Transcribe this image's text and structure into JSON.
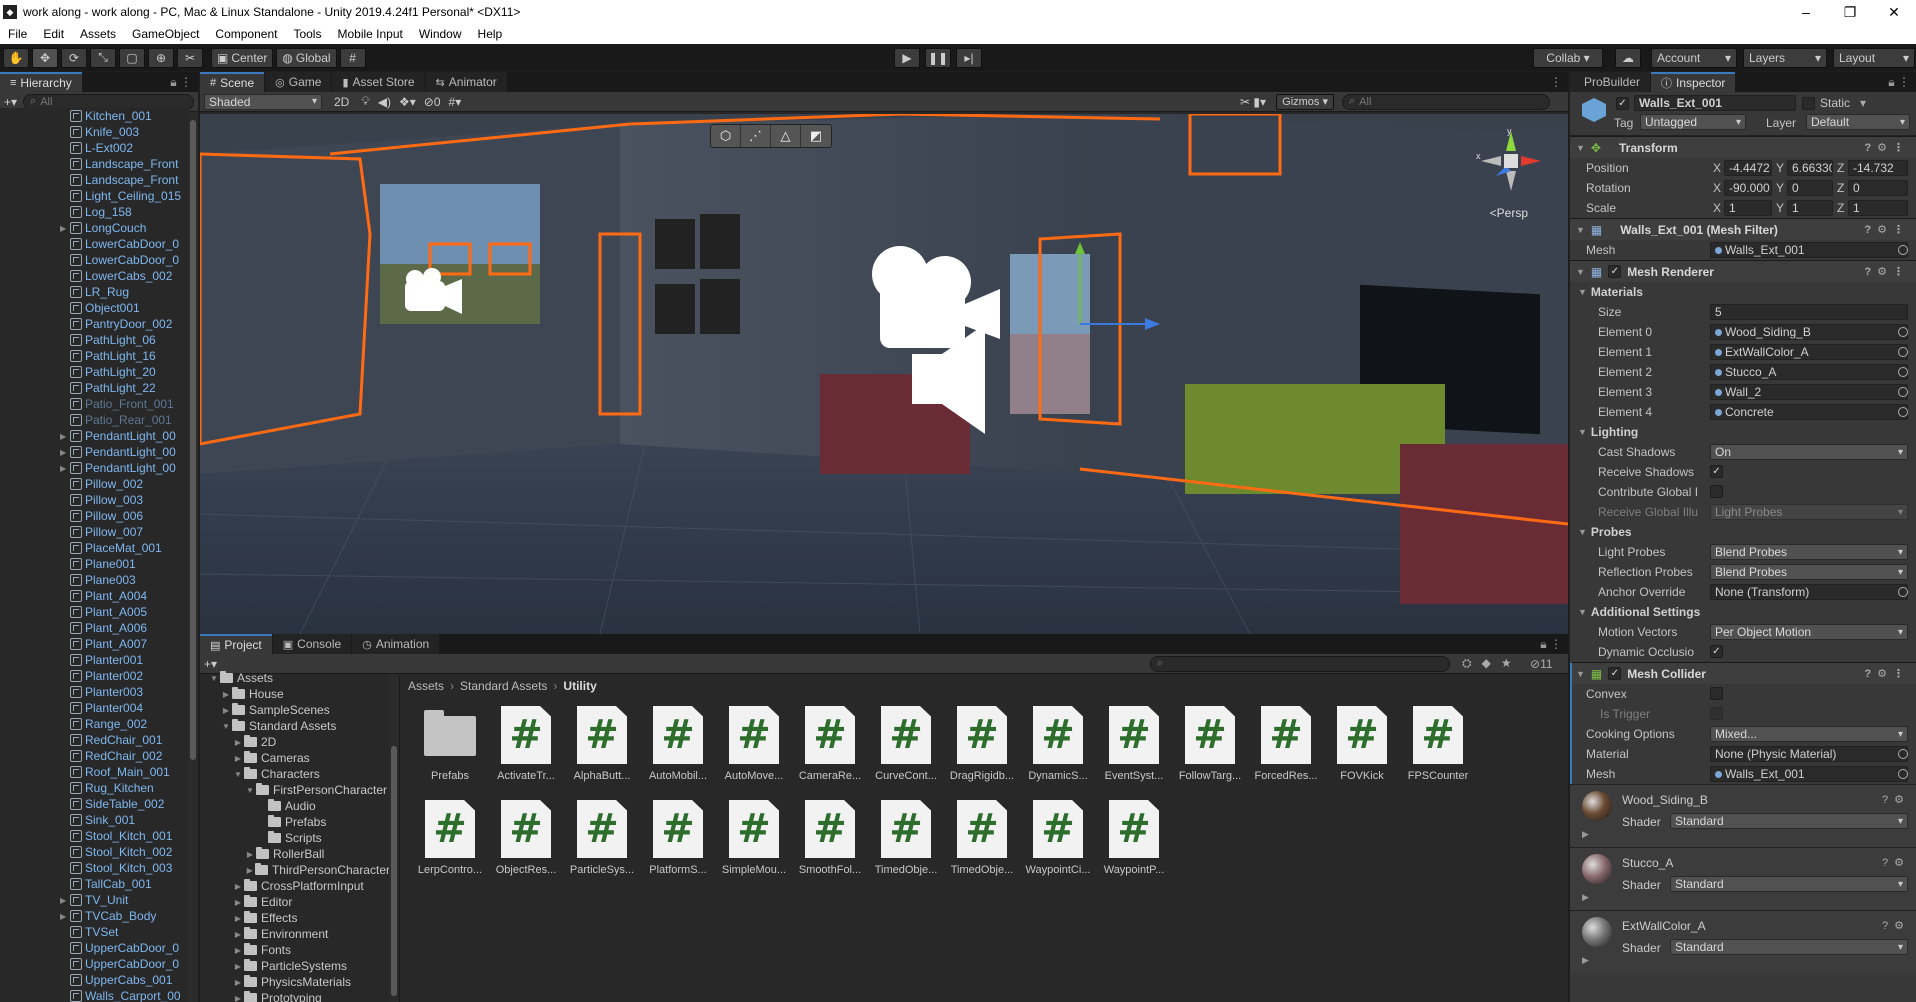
{
  "window": {
    "title": "work along - work along - PC, Mac & Linux Standalone - Unity 2019.4.24f1 Personal* <DX11>"
  },
  "menu": [
    "File",
    "Edit",
    "Assets",
    "GameObject",
    "Component",
    "Tools",
    "Mobile Input",
    "Window",
    "Help"
  ],
  "toolbar": {
    "center_label": "Center",
    "global_label": "Global",
    "collab_label": "Collab ▾",
    "account_label": "Account",
    "layers_label": "Layers",
    "layout_label": "Layout"
  },
  "hierarchy": {
    "tab": "Hierarchy",
    "search_placeholder": "All",
    "items": [
      {
        "name": "Kitchen_001",
        "arrow": false,
        "dim": false
      },
      {
        "name": "Knife_003",
        "arrow": false,
        "dim": false
      },
      {
        "name": "L-Ext002",
        "arrow": false,
        "dim": false
      },
      {
        "name": "Landscape_Front",
        "arrow": false,
        "dim": false
      },
      {
        "name": "Landscape_Front",
        "arrow": false,
        "dim": false
      },
      {
        "name": "Light_Ceiling_015",
        "arrow": false,
        "dim": false
      },
      {
        "name": "Log_158",
        "arrow": false,
        "dim": false
      },
      {
        "name": "LongCouch",
        "arrow": true,
        "dim": false
      },
      {
        "name": "LowerCabDoor_0",
        "arrow": false,
        "dim": false
      },
      {
        "name": "LowerCabDoor_0",
        "arrow": false,
        "dim": false
      },
      {
        "name": "LowerCabs_002",
        "arrow": false,
        "dim": false
      },
      {
        "name": "LR_Rug",
        "arrow": false,
        "dim": false
      },
      {
        "name": "Object001",
        "arrow": false,
        "dim": false
      },
      {
        "name": "PantryDoor_002",
        "arrow": false,
        "dim": false
      },
      {
        "name": "PathLight_06",
        "arrow": false,
        "dim": false
      },
      {
        "name": "PathLight_16",
        "arrow": false,
        "dim": false
      },
      {
        "name": "PathLight_20",
        "arrow": false,
        "dim": false
      },
      {
        "name": "PathLight_22",
        "arrow": false,
        "dim": false
      },
      {
        "name": "Patio_Front_001",
        "arrow": false,
        "dim": true
      },
      {
        "name": "Patio_Rear_001",
        "arrow": false,
        "dim": true
      },
      {
        "name": "PendantLight_00",
        "arrow": true,
        "dim": false
      },
      {
        "name": "PendantLight_00",
        "arrow": true,
        "dim": false
      },
      {
        "name": "PendantLight_00",
        "arrow": true,
        "dim": false
      },
      {
        "name": "Pillow_002",
        "arrow": false,
        "dim": false
      },
      {
        "name": "Pillow_003",
        "arrow": false,
        "dim": false
      },
      {
        "name": "Pillow_006",
        "arrow": false,
        "dim": false
      },
      {
        "name": "Pillow_007",
        "arrow": false,
        "dim": false
      },
      {
        "name": "PlaceMat_001",
        "arrow": false,
        "dim": false
      },
      {
        "name": "Plane001",
        "arrow": false,
        "dim": false
      },
      {
        "name": "Plane003",
        "arrow": false,
        "dim": false
      },
      {
        "name": "Plant_A004",
        "arrow": false,
        "dim": false
      },
      {
        "name": "Plant_A005",
        "arrow": false,
        "dim": false
      },
      {
        "name": "Plant_A006",
        "arrow": false,
        "dim": false
      },
      {
        "name": "Plant_A007",
        "arrow": false,
        "dim": false
      },
      {
        "name": "Planter001",
        "arrow": false,
        "dim": false
      },
      {
        "name": "Planter002",
        "arrow": false,
        "dim": false
      },
      {
        "name": "Planter003",
        "arrow": false,
        "dim": false
      },
      {
        "name": "Planter004",
        "arrow": false,
        "dim": false
      },
      {
        "name": "Range_002",
        "arrow": false,
        "dim": false
      },
      {
        "name": "RedChair_001",
        "arrow": false,
        "dim": false
      },
      {
        "name": "RedChair_002",
        "arrow": false,
        "dim": false
      },
      {
        "name": "Roof_Main_001",
        "arrow": false,
        "dim": false
      },
      {
        "name": "Rug_Kitchen",
        "arrow": false,
        "dim": false
      },
      {
        "name": "SideTable_002",
        "arrow": false,
        "dim": false
      },
      {
        "name": "Sink_001",
        "arrow": false,
        "dim": false
      },
      {
        "name": "Stool_Kitch_001",
        "arrow": false,
        "dim": false
      },
      {
        "name": "Stool_Kitch_002",
        "arrow": false,
        "dim": false
      },
      {
        "name": "Stool_Kitch_003",
        "arrow": false,
        "dim": false
      },
      {
        "name": "TallCab_001",
        "arrow": false,
        "dim": false
      },
      {
        "name": "TV_Unit",
        "arrow": true,
        "dim": false
      },
      {
        "name": "TVCab_Body",
        "arrow": true,
        "dim": false
      },
      {
        "name": "TVSet",
        "arrow": false,
        "dim": false
      },
      {
        "name": "UpperCabDoor_0",
        "arrow": false,
        "dim": false
      },
      {
        "name": "UpperCabDoor_0",
        "arrow": false,
        "dim": false
      },
      {
        "name": "UpperCabs_001",
        "arrow": false,
        "dim": false
      },
      {
        "name": "Walls_Carport_00",
        "arrow": false,
        "dim": false
      }
    ]
  },
  "scene": {
    "tabs": [
      "Scene",
      "Game",
      "Asset Store",
      "Animator"
    ],
    "shading": "Shaded",
    "mode_2d": "2D",
    "gizmos_label": "Gizmos",
    "search_placeholder": "All",
    "persp_label": "<Persp",
    "hidden_count": "0",
    "axis_y": "y",
    "axis_x": "x"
  },
  "project": {
    "tabs": [
      "Project",
      "Console",
      "Animation"
    ],
    "hidden_count": "11",
    "tree": [
      {
        "name": "Assets",
        "depth": 0,
        "arrow": "open"
      },
      {
        "name": "House",
        "depth": 1,
        "arrow": "closed"
      },
      {
        "name": "SampleScenes",
        "depth": 1,
        "arrow": "closed"
      },
      {
        "name": "Standard Assets",
        "depth": 1,
        "arrow": "open"
      },
      {
        "name": "2D",
        "depth": 2,
        "arrow": "closed"
      },
      {
        "name": "Cameras",
        "depth": 2,
        "arrow": "closed"
      },
      {
        "name": "Characters",
        "depth": 2,
        "arrow": "open"
      },
      {
        "name": "FirstPersonCharacter",
        "depth": 3,
        "arrow": "open"
      },
      {
        "name": "Audio",
        "depth": 4,
        "arrow": "none"
      },
      {
        "name": "Prefabs",
        "depth": 4,
        "arrow": "none"
      },
      {
        "name": "Scripts",
        "depth": 4,
        "arrow": "none"
      },
      {
        "name": "RollerBall",
        "depth": 3,
        "arrow": "closed"
      },
      {
        "name": "ThirdPersonCharacter",
        "depth": 3,
        "arrow": "closed"
      },
      {
        "name": "CrossPlatformInput",
        "depth": 2,
        "arrow": "closed"
      },
      {
        "name": "Editor",
        "depth": 2,
        "arrow": "closed"
      },
      {
        "name": "Effects",
        "depth": 2,
        "arrow": "closed"
      },
      {
        "name": "Environment",
        "depth": 2,
        "arrow": "closed"
      },
      {
        "name": "Fonts",
        "depth": 2,
        "arrow": "closed"
      },
      {
        "name": "ParticleSystems",
        "depth": 2,
        "arrow": "closed"
      },
      {
        "name": "PhysicsMaterials",
        "depth": 2,
        "arrow": "closed"
      },
      {
        "name": "Prototyping",
        "depth": 2,
        "arrow": "closed"
      }
    ],
    "breadcrumb": [
      "Assets",
      "Standard Assets",
      "Utility"
    ],
    "assets": [
      {
        "name": "Prefabs",
        "type": "folder"
      },
      {
        "name": "ActivateTr...",
        "type": "script"
      },
      {
        "name": "AlphaButt...",
        "type": "script"
      },
      {
        "name": "AutoMobil...",
        "type": "script"
      },
      {
        "name": "AutoMove...",
        "type": "script"
      },
      {
        "name": "CameraRe...",
        "type": "script"
      },
      {
        "name": "CurveCont...",
        "type": "script"
      },
      {
        "name": "DragRigidb...",
        "type": "script"
      },
      {
        "name": "DynamicS...",
        "type": "script"
      },
      {
        "name": "EventSyst...",
        "type": "script"
      },
      {
        "name": "FollowTarg...",
        "type": "script"
      },
      {
        "name": "ForcedRes...",
        "type": "script"
      },
      {
        "name": "FOVKick",
        "type": "script"
      },
      {
        "name": "FPSCounter",
        "type": "script"
      },
      {
        "name": "LerpContro...",
        "type": "script"
      },
      {
        "name": "ObjectRes...",
        "type": "script"
      },
      {
        "name": "ParticleSys...",
        "type": "script"
      },
      {
        "name": "PlatformS...",
        "type": "script"
      },
      {
        "name": "SimpleMou...",
        "type": "script"
      },
      {
        "name": "SmoothFol...",
        "type": "script"
      },
      {
        "name": "TimedObje...",
        "type": "script"
      },
      {
        "name": "TimedObje...",
        "type": "script"
      },
      {
        "name": "WaypointCi...",
        "type": "script"
      },
      {
        "name": "WaypointP...",
        "type": "script"
      }
    ]
  },
  "inspector": {
    "tabs": [
      "ProBuilder",
      "Inspector"
    ],
    "object_name": "Walls_Ext_001",
    "static_label": "Static",
    "tag_label": "Tag",
    "tag_value": "Untagged",
    "layer_label": "Layer",
    "layer_value": "Default",
    "transform": {
      "title": "Transform",
      "position_label": "Position",
      "rotation_label": "Rotation",
      "scale_label": "Scale",
      "position": {
        "x": "-4.4472",
        "y": "6.66330",
        "z": "-14.732"
      },
      "rotation": {
        "x": "-90.000",
        "y": "0",
        "z": "0"
      },
      "scale": {
        "x": "1",
        "y": "1",
        "z": "1"
      }
    },
    "mesh_filter": {
      "title": "Walls_Ext_001 (Mesh Filter)",
      "mesh_label": "Mesh",
      "mesh_value": "Walls_Ext_001"
    },
    "mesh_renderer": {
      "title": "Mesh Renderer",
      "materials_label": "Materials",
      "size_label": "Size",
      "size_value": "5",
      "elements": [
        {
          "label": "Element 0",
          "value": "Wood_Siding_B"
        },
        {
          "label": "Element 1",
          "value": "ExtWallColor_A"
        },
        {
          "label": "Element 2",
          "value": "Stucco_A"
        },
        {
          "label": "Element 3",
          "value": "Wall_2"
        },
        {
          "label": "Element 4",
          "value": "Concrete"
        }
      ],
      "lighting_label": "Lighting",
      "cast_shadows_label": "Cast Shadows",
      "cast_shadows_value": "On",
      "receive_shadows_label": "Receive Shadows",
      "contribute_gi_label": "Contribute Global I",
      "receive_gi_label": "Receive Global Illu",
      "receive_gi_value": "Light Probes",
      "probes_label": "Probes",
      "light_probes_label": "Light Probes",
      "light_probes_value": "Blend Probes",
      "reflection_probes_label": "Reflection Probes",
      "reflection_probes_value": "Blend Probes",
      "anchor_override_label": "Anchor Override",
      "anchor_override_value": "None (Transform)",
      "additional_label": "Additional Settings",
      "motion_vectors_label": "Motion Vectors",
      "motion_vectors_value": "Per Object Motion",
      "dynamic_occlusion_label": "Dynamic Occlusio"
    },
    "mesh_collider": {
      "title": "Mesh Collider",
      "convex_label": "Convex",
      "trigger_label": "Is Trigger",
      "cooking_label": "Cooking Options",
      "cooking_value": "Mixed...",
      "material_label": "Material",
      "material_value": "None (Physic Material)",
      "mesh_label": "Mesh",
      "mesh_value": "Walls_Ext_001"
    },
    "materials": [
      {
        "name": "Wood_Siding_B",
        "shader_label": "Shader",
        "shader": "Standard",
        "color": "#6b4a33"
      },
      {
        "name": "Stucco_A",
        "shader_label": "Shader",
        "shader": "Standard",
        "color": "#8a6a6e"
      },
      {
        "name": "ExtWallColor_A",
        "shader_label": "Shader",
        "shader": "Standard",
        "color": "#777777"
      }
    ]
  }
}
